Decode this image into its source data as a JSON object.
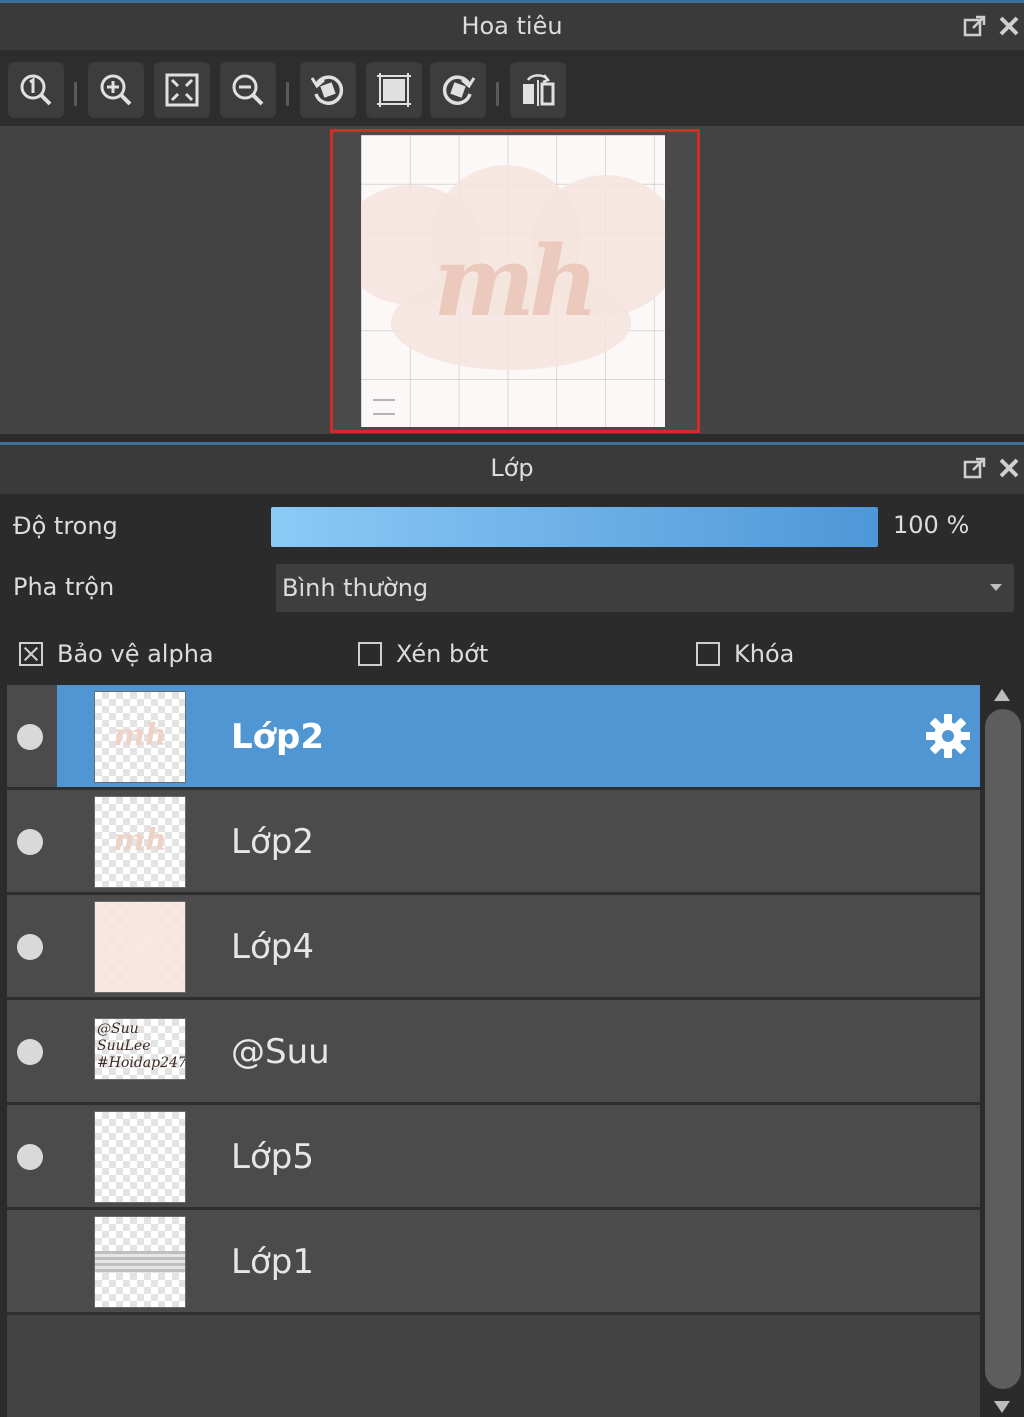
{
  "navigator": {
    "title": "Hoa tiêu",
    "canvas_mark": "mh",
    "tools": [
      {
        "icon": "zoom-actual-icon"
      },
      {
        "icon": "zoom-in-icon"
      },
      {
        "icon": "fit-window-icon"
      },
      {
        "icon": "zoom-out-icon"
      },
      {
        "icon": "rotate-left-icon"
      },
      {
        "icon": "reset-rotation-icon"
      },
      {
        "icon": "rotate-right-icon"
      },
      {
        "icon": "flip-horizontal-icon"
      }
    ],
    "view_rect_color": "#d42a2a"
  },
  "layers_panel": {
    "title": "Lớp",
    "opacity_label": "Độ trong",
    "opacity_value": "100 %",
    "opacity_fraction": 1.0,
    "blend_label": "Pha trộn",
    "blend_value": "Bình thường",
    "protect_alpha": {
      "label": "Bảo vệ alpha",
      "checked": true
    },
    "clipping": {
      "label": "Xén bớt",
      "checked": false
    },
    "lock": {
      "label": "Khóa",
      "checked": false
    },
    "accent": "#4f96d2",
    "layers": [
      {
        "name": "Lớp2",
        "selected": true,
        "visible": true,
        "thumb_mark": "mh"
      },
      {
        "name": "Lớp2",
        "selected": false,
        "visible": true,
        "thumb_mark": "mh"
      },
      {
        "name": "Lớp4",
        "selected": false,
        "visible": true
      },
      {
        "name": "@Suu",
        "selected": false,
        "visible": true,
        "thumb_text": "@Suu\nSuuLee\n#Hoidap247"
      },
      {
        "name": "Lớp5",
        "selected": false,
        "visible": true
      },
      {
        "name": "Lớp1",
        "selected": false,
        "visible": false
      }
    ]
  }
}
